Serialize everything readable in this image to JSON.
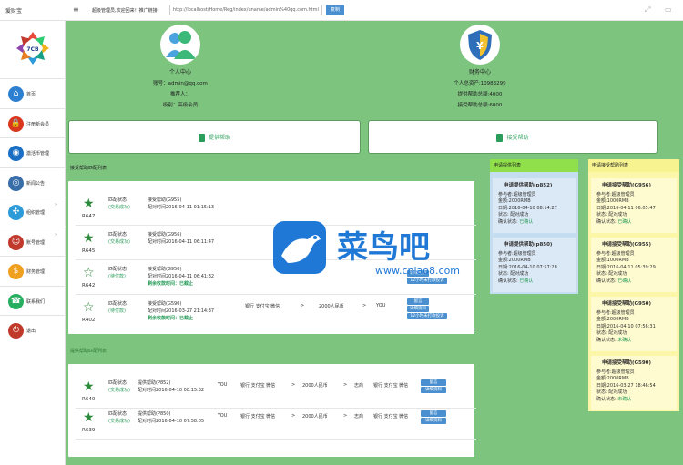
{
  "app": {
    "brand": "爱财宝",
    "welcome": "超级管理员,欢迎回来！推广链接：",
    "url": "http://localhost/Home/Reg/index/uname/admin%40qq.com.html",
    "copy": "复制"
  },
  "sidebar": {
    "items": [
      {
        "label": "首页",
        "icon": "house-icon",
        "arrow": ""
      },
      {
        "label": "注册新会员",
        "icon": "lock-icon",
        "arrow": ""
      },
      {
        "label": "激活币管理",
        "icon": "globe-icon",
        "arrow": ""
      },
      {
        "label": "新闻公告",
        "icon": "satellite-icon",
        "arrow": ""
      },
      {
        "label": "组织管理",
        "icon": "network-icon",
        "arrow": "»"
      },
      {
        "label": "账号管理",
        "icon": "users-icon",
        "arrow": "»"
      },
      {
        "label": "财务管理",
        "icon": "dollar-icon",
        "arrow": ""
      },
      {
        "label": "联系我们",
        "icon": "contact-icon",
        "arrow": ""
      },
      {
        "label": "退出",
        "icon": "power-icon",
        "arrow": ""
      }
    ]
  },
  "personal": {
    "title": "个人中心",
    "account": "账号：admin@qq.com",
    "referrer": "推荐人：",
    "level": "级别：高级会员"
  },
  "finance": {
    "title": "财务中心",
    "assets": "个人总资产:10983299",
    "provided": "提供帮助总额:4000",
    "received": "接受帮助总额:6000"
  },
  "actions": {
    "provide": "提供帮助",
    "receive": "接受帮助"
  },
  "receive_section": {
    "title": "接受帮助匹配列表",
    "rows": [
      {
        "id": "R647",
        "status": "匹配状态",
        "sub": "(交易成功)",
        "title": "接受帮助(G955)",
        "time": "配对时间2016-04-11 01:15:13",
        "left": "",
        "filled": true,
        "bank": "",
        "amount": "",
        "who": "",
        "btns": []
      },
      {
        "id": "R645",
        "status": "匹配状态",
        "sub": "(交易成功)",
        "title": "接受帮助(G956)",
        "time": "配对时间2016-04-11 06:11:47",
        "left": "",
        "filled": true,
        "bank": "",
        "amount": "",
        "who": "",
        "btns": []
      },
      {
        "id": "R642",
        "status": "匹配状态",
        "sub": "(待付款)",
        "title": "接受帮助(G950)",
        "time": "配对时间2016-04-11 06:41:32",
        "left": "剩余收款时间：已截止",
        "filled": false,
        "bank": "",
        "amount": "",
        "who": "",
        "btns": [
          "详细资料",
          "12小时未打款投诉"
        ]
      },
      {
        "id": "R402",
        "status": "匹配状态",
        "sub": "(待付款)",
        "title": "接受帮助(G590)",
        "time": "配对时间2016-03-27 21:14:37",
        "left": "剩余收款时间：已截止",
        "filled": false,
        "bank": "银行 支付宝 微信",
        "amount": "2000人民币",
        "who": "YOU",
        "btns": [
          "留言",
          "详细资料",
          "12小时未打款投诉"
        ]
      }
    ]
  },
  "provide_section": {
    "title": "提供帮助匹配列表",
    "rows": [
      {
        "id": "R640",
        "status": "匹配状态",
        "sub": "(交易成功)",
        "title": "提供帮助(P852)",
        "time": "配对时间2016-04-10 08:15:32",
        "who": "YOU",
        "bank": "银行 支付宝 微信",
        "amount": "2000人民币",
        "to": "志商",
        "bank2": "银行 支付宝 微信",
        "btns": [
          "留言",
          "详细资料"
        ]
      },
      {
        "id": "R639",
        "status": "匹配状态",
        "sub": "(交易成功)",
        "title": "提供帮助(P850)",
        "time": "配对时间2016-04-10 07:58:05",
        "who": "YOU",
        "bank": "银行 支付宝 微信",
        "amount": "2000人民币",
        "to": "志商",
        "bank2": "银行 支付宝 微信",
        "btns": [
          "留言",
          "详细资料"
        ]
      }
    ]
  },
  "provide_list": {
    "title": "申请提供列表",
    "items": [
      {
        "title": "申请提供帮助(p852)",
        "user": "参与者:超级管理员",
        "amount": "金额:2000RMB",
        "date": "日期:2016-04-10 08:14:27",
        "state": "状态: 配对成功",
        "confirm": "确认状态:",
        "confirm_val": "已确认"
      },
      {
        "title": "申请提供帮助(p850)",
        "user": "参与者:超级管理员",
        "amount": "金额:2000RMB",
        "date": "日期:2016-04-10 07:57:28",
        "state": "状态: 配对成功",
        "confirm": "确认状态:",
        "confirm_val": "已确认"
      }
    ]
  },
  "receive_list": {
    "title": "申请接受帮助列表",
    "items": [
      {
        "title": "申请接受帮助(G956)",
        "user": "参与者:超级管理员",
        "amount": "金额:1000RMB",
        "date": "日期:2016-04-11 06:05:47",
        "state": "状态: 配对成功",
        "confirm": "确认状态:",
        "confirm_val": "已确认"
      },
      {
        "title": "申请接受帮助(G955)",
        "user": "参与者:超级管理员",
        "amount": "金额:1000RMB",
        "date": "日期:2016-04-11 05:39:29",
        "state": "状态: 配对成功",
        "confirm": "确认状态:",
        "confirm_val": "已确认"
      },
      {
        "title": "申请接受帮助(G950)",
        "user": "参与者:超级管理员",
        "amount": "金额:2000RMB",
        "date": "日期:2016-04-10 07:56:31",
        "state": "状态: 配对成功",
        "confirm": "确认状态:",
        "confirm_val": "未确认"
      },
      {
        "title": "申请接受帮助(G590)",
        "user": "参与者:超级管理员",
        "amount": "金额:2000RMB",
        "date": "日期:2016-03-27 18:46:54",
        "state": "状态: 配对成功",
        "confirm": "确认状态:",
        "confirm_val": "未确认"
      }
    ]
  },
  "watermark": {
    "title": "菜鸟吧",
    "url": "www.cniao8.com"
  },
  "colors": {
    "main_bg": "#7dc47f",
    "accent_green": "#2a9d5a",
    "button_blue": "#4a90d0",
    "provide_panel": "#dbe8f5",
    "provide_head": "#8fe04a",
    "receive_panel": "#fbf6a8",
    "receive_head": "#f6f390"
  }
}
